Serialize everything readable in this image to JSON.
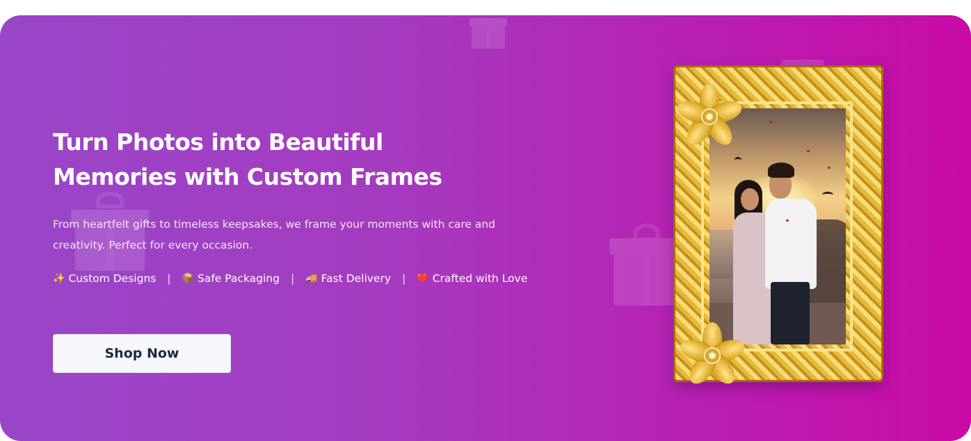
{
  "hero": {
    "headline_line1": "Turn Photos into Beautiful",
    "headline_line2": "Memories with Custom Frames",
    "subtitle_line1": "From heartfelt gifts to timeless keepsakes, we frame your moments with care and",
    "subtitle_line2": "creativity. Perfect for every occasion.",
    "features": [
      {
        "emoji": "✨",
        "label": "Custom Designs",
        "icon": "sparkles-icon"
      },
      {
        "emoji": "📦",
        "label": "Safe Packaging",
        "icon": "package-icon"
      },
      {
        "emoji": "🚚",
        "label": "Fast Delivery",
        "icon": "delivery-truck-icon"
      },
      {
        "emoji": "❤️",
        "label": "Crafted with Love",
        "icon": "heart-icon"
      }
    ],
    "separator": "|",
    "cta_label": "Shop Now"
  },
  "colors": {
    "gradient_start": "#9a46c8",
    "gradient_end": "#c90aa6",
    "button_bg": "#f6f8fb",
    "button_text": "#1b2a44",
    "frame_gold": "#e7b93a"
  },
  "image": {
    "subject": "couple-portrait-in-ornate-gold-floral-frame"
  }
}
